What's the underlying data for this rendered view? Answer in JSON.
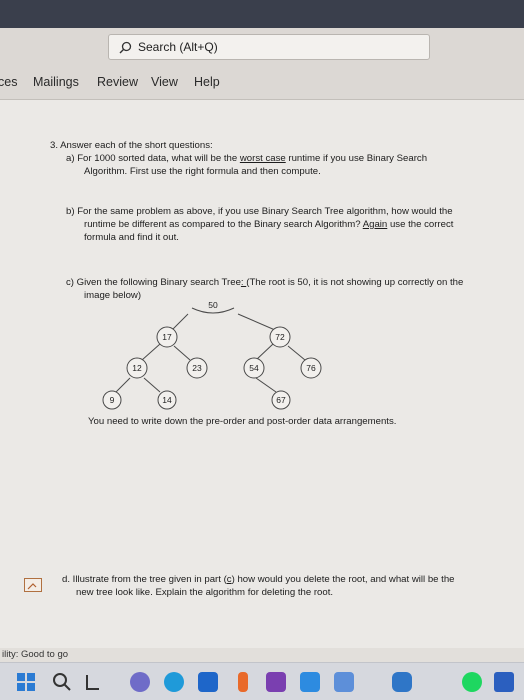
{
  "search": {
    "label": "Search (Alt+Q)"
  },
  "ribbon": {
    "tabs": [
      "ces",
      "Mailings",
      "Review",
      "View",
      "Help"
    ]
  },
  "document": {
    "q3_title": "3.   Answer each of the short questions:",
    "a_line1": "a)   For 1000 sorted data, what will be the",
    "a_underlined": "worst case",
    "a_line1_end": " runtime if you use Binary Search",
    "a_line2": "Algorithm. First use the right formula and then compute.",
    "b_line1": "b)   For the same problem as above, if you use Binary Search Tree algorithm, how would the",
    "b_line2": "runtime be different as compared to the Binary search Algorithm?",
    "b_again": "Again",
    "b_line2_end": " use the correct",
    "b_line3": "formula and find it out.",
    "c_line1_start": "c)   Given the following Binary search Tree",
    "c_line1_colon": ": ",
    "c_line1_end": "(The root is 50, it is not showing up correctly on the",
    "c_line2": "image below)",
    "root_label": "50",
    "tree_nodes": [
      "17",
      "72",
      "12",
      "23",
      "54",
      "76",
      "9",
      "14",
      "67"
    ],
    "c_footer": "You need to write down the pre-order and post-order data arrangements.",
    "d_line1_start": "d.   Illustrate from the tree given in part (",
    "d_part": "c",
    "d_line1_end": ") how would you delete the root, and what will be the",
    "d_line2": "new tree look like. Explain the algorithm for deleting the root."
  },
  "status": {
    "accessibility": "ility: Good to go"
  },
  "taskbar": {
    "icons": [
      "windows-start-icon",
      "search-icon",
      "task-view-icon",
      "teams-icon",
      "edge-icon",
      "mail-icon",
      "office-icon",
      "chrome-icon",
      "linkedin-icon",
      "media-icon",
      "explorer-icon",
      "spotify-icon",
      "word-icon"
    ]
  },
  "colors": {
    "title_bar": "#3a3f4c",
    "ribbon": "#dcd8d4",
    "page": "#ebe9e6",
    "taskbar": "#d6d8de"
  }
}
